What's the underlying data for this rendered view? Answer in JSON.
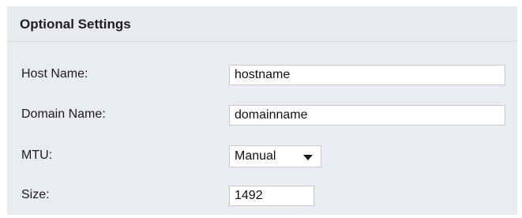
{
  "section": {
    "title": "Optional Settings"
  },
  "fields": {
    "host_name": {
      "label": "Host Name:",
      "value": "hostname"
    },
    "domain_name": {
      "label": "Domain Name:",
      "value": "domainname"
    },
    "mtu": {
      "label": "MTU:",
      "selected": "Manual",
      "icon": "chevron-down-icon"
    },
    "size": {
      "label": "Size:",
      "value": "1492"
    }
  },
  "colors": {
    "panel_background": "#e9ecf1",
    "input_background": "#ffffff",
    "input_border": "#c6c9ce"
  }
}
